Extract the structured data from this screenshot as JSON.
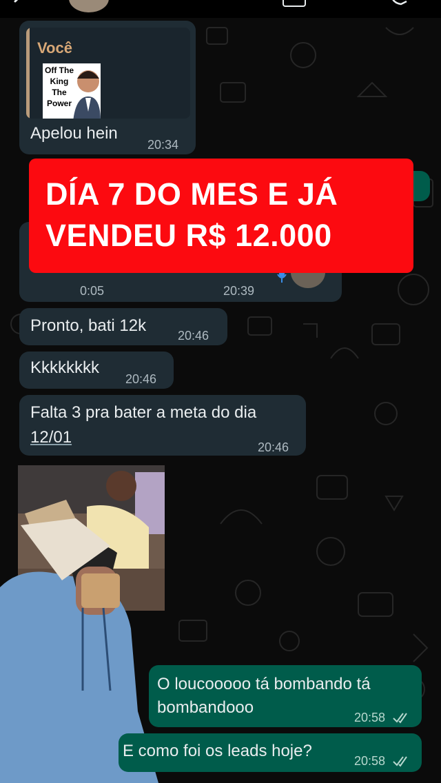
{
  "header": {
    "back_icon": "chevron-left-icon",
    "avatar": "contact-avatar",
    "video_icon": "video-call-icon",
    "call_icon": "phone-icon"
  },
  "overlay": {
    "line1": "DÍA 7 DO MES E JÁ",
    "line2": "VENDEU R$ 12.000",
    "color": "#fc0a10"
  },
  "messages": [
    {
      "quote_author": "Você",
      "quote_thumb_lines": [
        "Off The",
        "King",
        "The",
        "Power"
      ],
      "text": "Apelou hein",
      "time": "20:34"
    },
    {
      "voice_duration": "0:05",
      "time": "20:39"
    },
    {
      "text": "Pronto, bati 12k",
      "time": "20:46"
    },
    {
      "text": "Kkkkkkkk",
      "time": "20:46"
    },
    {
      "text_line1": "Falta 3 pra bater a meta do dia",
      "text_line2": "12/01",
      "time": "20:46"
    },
    {
      "text_line1": "O loucooooo tá bombando tá",
      "text_line2": "bombandooo",
      "time": "20:58"
    },
    {
      "text": "E como foi os leads hoje?",
      "time": "20:58"
    }
  ],
  "colors": {
    "incoming_bubble": "#1f2c34",
    "outgoing_bubble": "#005c4b",
    "background": "#0b0b0b"
  }
}
